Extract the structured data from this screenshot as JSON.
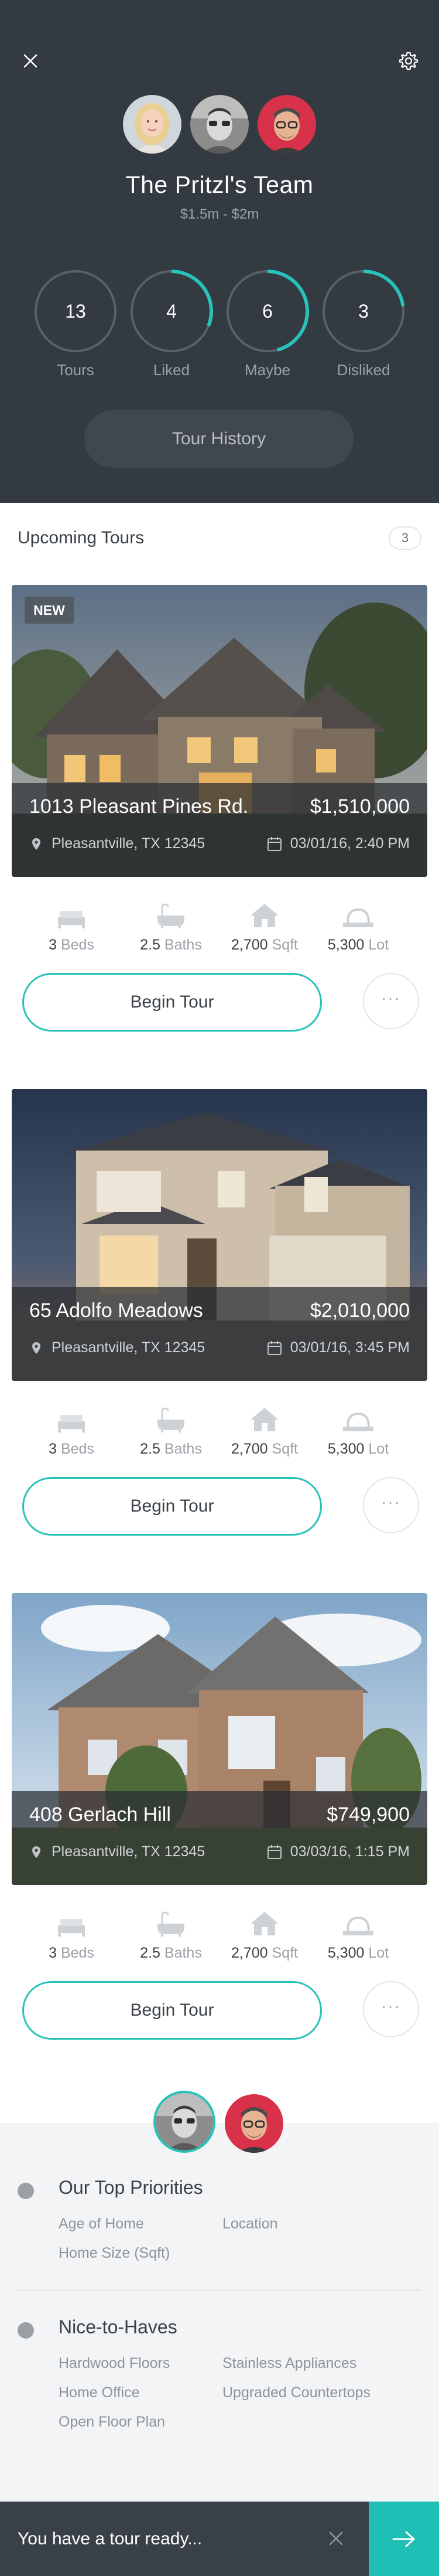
{
  "header": {
    "close_icon": "close-icon",
    "settings_icon": "gear-icon",
    "team_name": "The Pritzl's Team",
    "price_range": "$1.5m - $2m",
    "stats": [
      {
        "value": "13",
        "label": "Tours",
        "progress": 0
      },
      {
        "value": "4",
        "label": "Liked",
        "progress": 0.31
      },
      {
        "value": "6",
        "label": "Maybe",
        "progress": 0.46
      },
      {
        "value": "3",
        "label": "Disliked",
        "progress": 0.23
      }
    ],
    "tour_history_label": "Tour History",
    "accent_color": "#27c3bb",
    "background_color": "#343a41"
  },
  "upcoming": {
    "title": "Upcoming Tours",
    "count": "3"
  },
  "tours": [
    {
      "badge": "NEW",
      "address": "1013 Pleasant Pines Rd.",
      "price": "$1,510,000",
      "city": "Pleasantville, TX 12345",
      "datetime": "03/01/16, 2:40 PM",
      "beds": "3",
      "beds_unit": "Beds",
      "baths": "2.5",
      "baths_unit": "Baths",
      "sqft": "2,700",
      "sqft_unit": "Sqft",
      "lot": "5,300",
      "lot_unit": "Lot",
      "cta": "Begin Tour",
      "more": "···"
    },
    {
      "badge": "",
      "address": "65 Adolfo Meadows",
      "price": "$2,010,000",
      "city": "Pleasantville, TX 12345",
      "datetime": "03/01/16, 3:45 PM",
      "beds": "3",
      "beds_unit": "Beds",
      "baths": "2.5",
      "baths_unit": "Baths",
      "sqft": "2,700",
      "sqft_unit": "Sqft",
      "lot": "5,300",
      "lot_unit": "Lot",
      "cta": "Begin Tour",
      "more": "···"
    },
    {
      "badge": "",
      "address": "408 Gerlach Hill",
      "price": "$749,900",
      "city": "Pleasantville, TX 12345",
      "datetime": "03/03/16, 1:15 PM",
      "beds": "3",
      "beds_unit": "Beds",
      "baths": "2.5",
      "baths_unit": "Baths",
      "sqft": "2,700",
      "sqft_unit": "Sqft",
      "lot": "5,300",
      "lot_unit": "Lot",
      "cta": "Begin Tour",
      "more": "···"
    }
  ],
  "priorities": {
    "top_title": "Our Top Priorities",
    "top_items": [
      "Age of Home",
      "Location",
      "Home Size (Sqft)"
    ],
    "nice_title": "Nice-to-Haves",
    "nice_items": [
      "Hardwood Floors",
      "Stainless Appliances",
      "Home Office",
      "Upgraded Countertops",
      "Open Floor Plan"
    ]
  },
  "bottom_bar": {
    "message": "You have a tour ready...",
    "dismiss_icon": "close-icon",
    "go_icon": "arrow-right-icon"
  }
}
